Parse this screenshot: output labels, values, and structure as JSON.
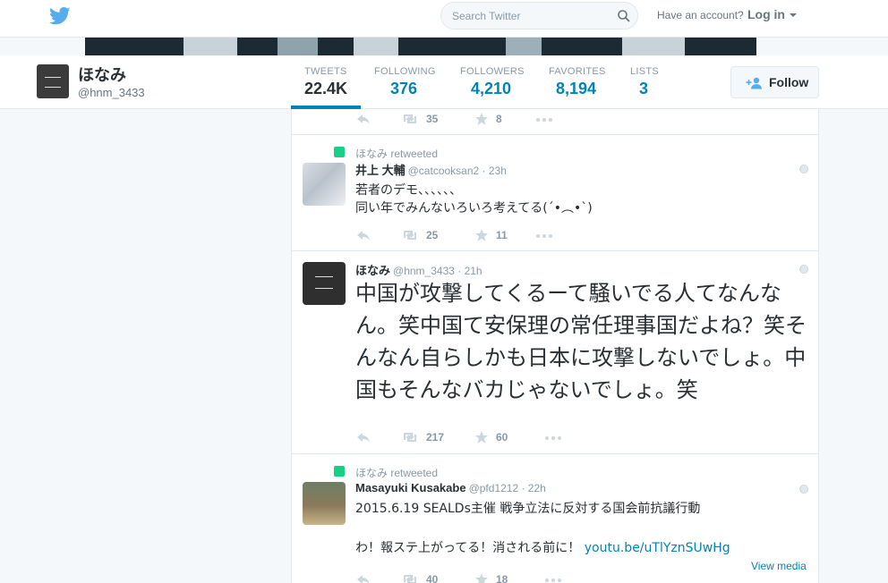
{
  "topbar": {
    "search_placeholder": "Search Twitter",
    "have_account": "Have an account?",
    "login_label": "Log in"
  },
  "profile": {
    "name": "ほなみ",
    "handle": "@hnm_3433"
  },
  "stats": [
    {
      "label": "TWEETS",
      "value": "22.4K",
      "active": true
    },
    {
      "label": "FOLLOWING",
      "value": "376"
    },
    {
      "label": "FOLLOWERS",
      "value": "4,210"
    },
    {
      "label": "FAVORITES",
      "value": "8,194"
    },
    {
      "label": "LISTS",
      "value": "3"
    }
  ],
  "follow_label": "Follow",
  "colors": {
    "accent": "#0084b4",
    "retweet_green": "#19cf86",
    "muted": "#8899a6",
    "twitter_blue": "#55acee"
  },
  "tweets": [
    {
      "retweets": "35",
      "favorites": "8"
    },
    {
      "retweeted_by": "ほなみ retweeted",
      "fullname": "井上 大輔",
      "meta": "@catcooksan2 · 23h",
      "text": "若者のデモ、、、、、、\n同い年でみんないろいろ考えてる(´•︵•`)",
      "retweets": "25",
      "favorites": "11"
    },
    {
      "fullname": "ほなみ",
      "meta": "@hnm_3433 · 21h",
      "text": "中国が攻撃してくるーて騒いでる人てなんなん。笑中国て安保理の常任理事国だよね？笑そんなん自らしかも日本に攻撃しないでしょ。中国もそんなバカじゃないでしょ。笑",
      "retweets": "217",
      "favorites": "60"
    },
    {
      "retweeted_by": "ほなみ retweeted",
      "fullname": "Masayuki Kusakabe",
      "meta": "@pfd1212 · 22h",
      "text_line1": "2015.6.19 SEALDs主催 戦争立法に反対する国会前抗議行動",
      "text_line2": "わ！報ステ上がってる！消される前に！",
      "link": "youtu.be/uTlYznSUwHg",
      "view_media": "View media",
      "retweets": "40",
      "favorites": "18"
    }
  ]
}
